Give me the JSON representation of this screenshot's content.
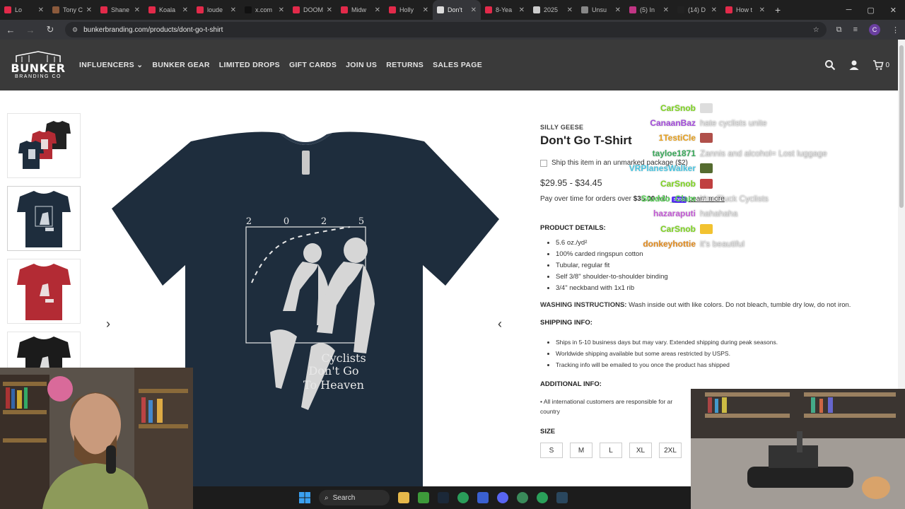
{
  "browser": {
    "tabs": [
      {
        "label": "Lo",
        "color": "#e22a4a"
      },
      {
        "label": "Tony C",
        "color": "#8b5a3c"
      },
      {
        "label": "Shane",
        "color": "#e22a4a"
      },
      {
        "label": "Koala",
        "color": "#e22a4a"
      },
      {
        "label": "loude",
        "color": "#e22a4a"
      },
      {
        "label": "x.com",
        "color": "#111111"
      },
      {
        "label": "DOOM",
        "color": "#e22a4a"
      },
      {
        "label": "Midw",
        "color": "#e22a4a"
      },
      {
        "label": "Holly",
        "color": "#e22a4a"
      },
      {
        "label": "Don't",
        "color": "#dddddd",
        "active": true
      },
      {
        "label": "8-Yea",
        "color": "#e22a4a"
      },
      {
        "label": "2025",
        "color": "#cccccc"
      },
      {
        "label": "Unsu",
        "color": "#888888"
      },
      {
        "label": "(5) In",
        "color": "#c13584"
      },
      {
        "label": "(14) D",
        "color": "#222222"
      },
      {
        "label": "How t",
        "color": "#e22a4a"
      }
    ],
    "new_tab": "+",
    "url": "bunkerbranding.com/products/dont-go-t-shirt",
    "profile_initial": "C"
  },
  "header": {
    "logo_text": "BUNKER",
    "logo_sub": "BRANDING CO",
    "nav": [
      "INFLUENCERS",
      "BUNKER GEAR",
      "LIMITED DROPS",
      "GIFT CARDS",
      "JOIN US",
      "RETURNS",
      "SALES PAGE"
    ],
    "cart_count": "0"
  },
  "product": {
    "vendor": "SILLY GEESE",
    "title": "Don't Go T-Shirt",
    "ship_option": "Ship this item in an unmarked package ($2)",
    "price": "$29.95 - $34.45",
    "pay_over_prefix": "Pay over time for orders over ",
    "pay_over_amount": "$35.00",
    "pay_over_with": " with ",
    "shop_logo": "shop",
    "learn_more": "Learn more",
    "details_heading": "PRODUCT DETAILS:",
    "details": [
      "5.6 oz./yd²",
      "100% carded ringspun cotton",
      "Tubular, regular fit",
      "Self 3/8\" shoulder-to-shoulder binding",
      "3/4\" neckband with 1x1 rib"
    ],
    "washing_heading": "WASHING INSTRUCTIONS:",
    "washing_text": " Wash inside out with like colors. Do not bleach, tumble dry low, do not iron.",
    "shipping_heading": "SHIPPING INFO:",
    "shipping": [
      "Ships in 5-10 business days but may vary. Extended shipping during peak seasons.",
      "Worldwide shipping available but some areas restricted by USPS.",
      "Tracking info will be emailed to you once the product has shipped"
    ],
    "additional_heading": "ADDITIONAL INFO:",
    "additional_line1": "• All international customers are responsible for ar",
    "additional_line2": "country",
    "size_heading": "SIZE",
    "sizes": [
      "S",
      "M",
      "L",
      "XL",
      "2XL"
    ]
  },
  "shirt": {
    "year_digits": [
      "2",
      "0",
      "2",
      "5"
    ],
    "line1": "Cyclists",
    "line2": "Don't Go",
    "line3": "To Heaven",
    "color": "#1e2d3d"
  },
  "chat": [
    {
      "name": "CarSnob",
      "msg": "",
      "color": "#7ed321",
      "emote": "#dddddd"
    },
    {
      "name": "CanaanBaz",
      "msg": "hate cyclists unite",
      "color": "#a24bd9"
    },
    {
      "name": "1TestiCle",
      "msg": "",
      "color": "#e6a020",
      "emote": "#b0504a"
    },
    {
      "name": "tayloe1871",
      "msg": "Zannis and alcohol= Lost luggage",
      "color": "#3aa85a"
    },
    {
      "name": "VRPlanesWalker",
      "msg": "",
      "color": "#4ac5e0",
      "emote": "#556b2f"
    },
    {
      "name": "CarSnob",
      "msg": "",
      "color": "#7ed321",
      "emote": "#c04040"
    },
    {
      "name": "Studdo_Clam",
      "msg": "You Fluck Cyclists",
      "color": "#5ad45a"
    },
    {
      "name": "hazaraputi",
      "msg": "hahahaha",
      "color": "#c25ad4"
    },
    {
      "name": "CarSnob",
      "msg": "",
      "color": "#7ed321",
      "emote": "#f2c230"
    },
    {
      "name": "donkeyhottie",
      "msg": "it's beautiful",
      "color": "#e08a1e"
    }
  ],
  "taskbar": {
    "search_label": "Search"
  }
}
